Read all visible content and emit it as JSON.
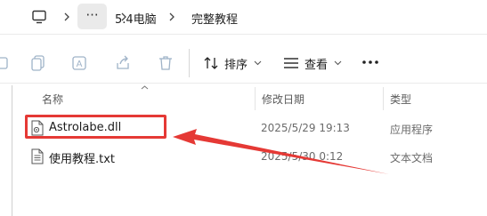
{
  "address_bar": {
    "icons": {
      "computer": "computer-icon",
      "separator": "chevron-right-icon",
      "overflow": "ellipsis-icon"
    },
    "overflow_label": "···",
    "breadcrumbs": [
      "5.4电脑",
      "完整教程"
    ]
  },
  "toolbar": {
    "icons": [
      "new-icon",
      "copy-icon",
      "rename-icon",
      "share-icon",
      "delete-icon"
    ],
    "sort": {
      "icon": "sort-icon",
      "label": "排序"
    },
    "view": {
      "icon": "view-icon",
      "label": "查看"
    },
    "more_icon": "more-options-icon"
  },
  "columns": {
    "name": "名称",
    "modified": "修改日期",
    "type": "类型"
  },
  "files": [
    {
      "name": "Astrolabe.dll",
      "modified": "2025/5/29 19:13",
      "type": "应用程序",
      "icon": "dll-file-icon",
      "highlighted": true
    },
    {
      "name": "使用教程.txt",
      "modified": "2025/5/30 0:12",
      "type": "文本文档",
      "icon": "text-file-icon",
      "highlighted": false
    }
  ],
  "annotation": {
    "color": "#e53935",
    "target": "Astrolabe.dll"
  },
  "colors": {
    "accent": "#e53935",
    "background": "#ffffff",
    "text_secondary": "#6b6b6b"
  }
}
